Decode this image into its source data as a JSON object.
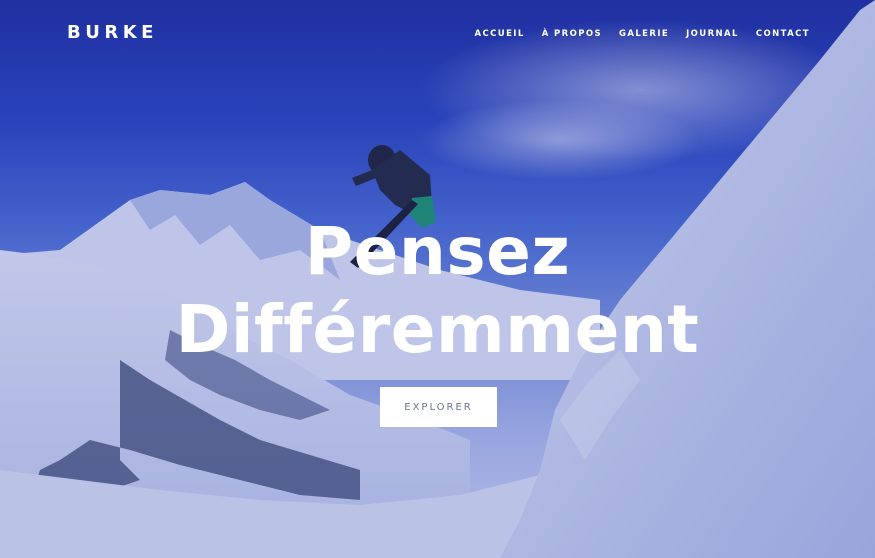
{
  "site": {
    "logo": "BURKE"
  },
  "nav": {
    "items": [
      {
        "label": "ACCUEIL"
      },
      {
        "label": "À PROPOS"
      },
      {
        "label": "GALERIE"
      },
      {
        "label": "JOURNAL"
      },
      {
        "label": "CONTACT"
      }
    ]
  },
  "hero": {
    "headline_line1": "Pensez",
    "headline_line2": "Différemment",
    "cta_label": "EXPLORER",
    "background_image": "snowboarder-jumping-mountain-photo"
  },
  "colors": {
    "sky_top": "#1f2f9e",
    "sky_mid": "#4d6fd6",
    "snow": "#e6eaf8",
    "cta_text": "#6a7290",
    "text": "#ffffff"
  }
}
